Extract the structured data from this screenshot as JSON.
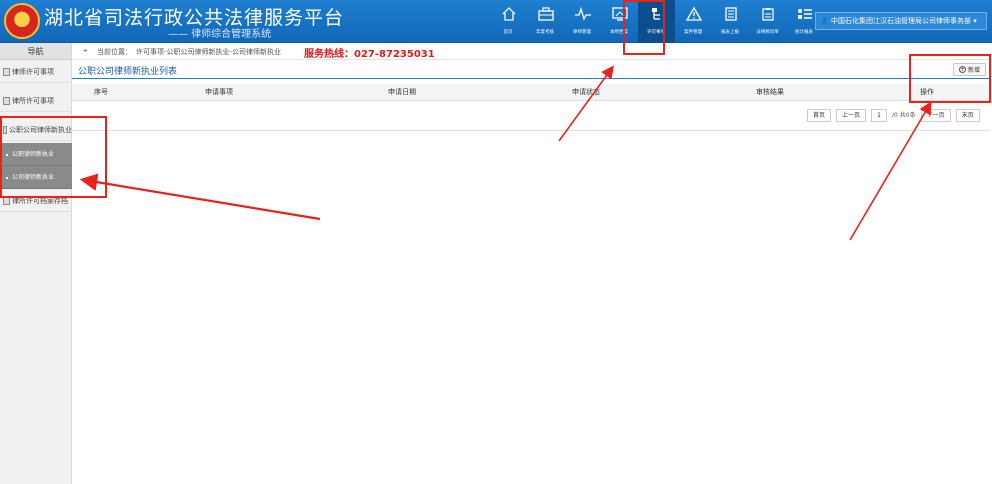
{
  "header": {
    "title": "湖北省司法行政公共法律服务平台",
    "subtitle": "律师综合管理系统",
    "nav": [
      {
        "label": "首页",
        "icon": "home-icon"
      },
      {
        "label": "年度考核",
        "icon": "briefcase-icon"
      },
      {
        "label": "律师管理",
        "icon": "pulse-icon"
      },
      {
        "label": "本所档案",
        "icon": "monitor-icon"
      },
      {
        "label": "许可事项",
        "icon": "tree-icon",
        "active": true
      },
      {
        "label": "案件管理",
        "icon": "warning-icon"
      },
      {
        "label": "报表上报",
        "icon": "document-icon"
      },
      {
        "label": "法律顾问单",
        "icon": "clipboard-icon"
      },
      {
        "label": "统计报表",
        "icon": "list-icon"
      }
    ],
    "user": "中国石化集团江汉石油管理局公司律师事务部"
  },
  "sidebar": {
    "title": "导航",
    "items": [
      {
        "label": "律师许可事项"
      },
      {
        "label": "律所许可事项"
      },
      {
        "label": "公职公司律师新执业"
      },
      {
        "label": "律所许可档案存档"
      }
    ],
    "subitems": [
      {
        "label": "公职律师新执业"
      },
      {
        "label": "公司律师新执业"
      }
    ]
  },
  "breadcrumb": {
    "prefix": "当前位置：",
    "path": "许可事项-公职公司律师新执业-公司律师新执业"
  },
  "hotline": "服务热线：027-87235031",
  "panel": {
    "title": "公职公司律师新执业列表",
    "add_label": "新增"
  },
  "table": {
    "headers": [
      "序号",
      "申请事项",
      "申请日期",
      "申请状态",
      "审核结果",
      "操作"
    ]
  },
  "pager": {
    "first": "首页",
    "prev": "上一页",
    "page": "1",
    "info": "/0 共0条",
    "next": "下一页",
    "last": "末页"
  }
}
